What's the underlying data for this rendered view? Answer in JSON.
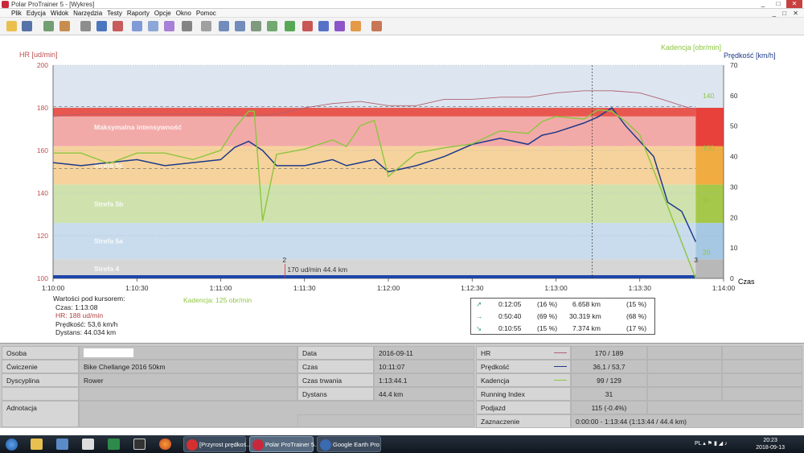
{
  "window": {
    "title": "Polar ProTrainer 5 - [Wykres]",
    "buttons": [
      "_",
      "□",
      "✕"
    ]
  },
  "menu": [
    "Plik",
    "Edycja",
    "Widok",
    "Narzędzia",
    "Testy",
    "Raporty",
    "Opcje",
    "Okno",
    "Pomoc"
  ],
  "toolbar_icons": [
    {
      "name": "open-folder-icon",
      "color": "#e8b530"
    },
    {
      "name": "save-icon",
      "color": "#3a5a99"
    },
    {
      "name": "add-exercise-icon",
      "color": "#5a8f5a"
    },
    {
      "name": "exercise-icon",
      "color": "#c07a30"
    },
    {
      "name": "calendar-icon",
      "color": "#7a7a7a"
    },
    {
      "name": "notebook-icon",
      "color": "#2d5fb5"
    },
    {
      "name": "edit-icon",
      "color": "#c04040"
    },
    {
      "name": "line-chart-icon",
      "color": "#6a8ad0"
    },
    {
      "name": "bar-chart-icon",
      "color": "#7a9ad0"
    },
    {
      "name": "percent-chart-icon",
      "color": "#9a6ad0"
    },
    {
      "name": "table-icon",
      "color": "#707070"
    },
    {
      "name": "zoom-icon",
      "color": "#909090"
    },
    {
      "name": "upload-icon",
      "color": "#5a7ab0"
    },
    {
      "name": "download-icon",
      "color": "#5a7ab0"
    },
    {
      "name": "sync-icon",
      "color": "#6a8a6a"
    },
    {
      "name": "wave-icon",
      "color": "#5a9a5a"
    },
    {
      "name": "report-green-icon",
      "color": "#3a9a3a"
    },
    {
      "name": "report-red-icon",
      "color": "#c03a3a"
    },
    {
      "name": "report-blue-icon",
      "color": "#3a5ac0"
    },
    {
      "name": "report-purple-icon",
      "color": "#7a3ac0"
    },
    {
      "name": "report-orange-icon",
      "color": "#e08a2a"
    },
    {
      "name": "users-icon",
      "color": "#c0603a"
    }
  ],
  "chart_data": {
    "type": "line",
    "left_axis_label": "HR [ud/min]",
    "right_axis_label_cadence": "Kadencja [obr/min]",
    "right_axis_label_speed": "Prędkość [km/h]",
    "x_axis_label": "Czas",
    "x_ticks": [
      "1:10:00",
      "1:10:30",
      "1:11:00",
      "1:11:30",
      "1:12:00",
      "1:12:30",
      "1:13:00",
      "1:13:30",
      "1:14:00"
    ],
    "x_range": [
      0,
      240
    ],
    "hr_ticks": [
      "100",
      "120",
      "140",
      "160",
      "180",
      "200"
    ],
    "hr_range": [
      100,
      200
    ],
    "speed_ticks": [
      "0",
      "10",
      "20",
      "30",
      "40",
      "50",
      "60",
      "70"
    ],
    "speed_range": [
      0,
      70
    ],
    "cadence_ticks": [
      "20",
      "60",
      "100",
      "140"
    ],
    "zones": [
      {
        "label": "Strefa 4",
        "from": 100,
        "to": 109,
        "color": "#d6d6d6",
        "edge_color": "#b8b8b8"
      },
      {
        "label": "Strefa 5a",
        "from": 109,
        "to": 126,
        "color": "#c8dced",
        "edge_color": "#a6c8e2"
      },
      {
        "label": "Strefa 5b",
        "from": 126,
        "to": 144,
        "color": "#cfe2ae",
        "edge_color": "#a6c84a"
      },
      {
        "label": "Strefa 5c",
        "from": 144,
        "to": 162,
        "color": "#f6d39c",
        "edge_color": "#f0ac40"
      },
      {
        "label": "Maksymalna intensywność",
        "from": 162,
        "to": 180,
        "color": "#f2aaa8",
        "edge_color": "#e8403a"
      }
    ],
    "series": [
      {
        "name": "HR",
        "color": "#b06070",
        "x": [
          0,
          10,
          20,
          30,
          40,
          50,
          60,
          70,
          80,
          90,
          100,
          110,
          120,
          130,
          140,
          150,
          160,
          170,
          180,
          190,
          200,
          210,
          218,
          225,
          230
        ],
        "y": [
          176,
          177,
          177,
          177,
          177,
          177,
          177,
          176,
          177,
          180,
          182,
          183,
          181,
          181,
          184,
          184,
          185,
          185,
          187,
          188,
          188,
          187,
          184,
          181,
          179
        ]
      },
      {
        "name": "Prędkość",
        "color": "#1e3a8a",
        "x": [
          0,
          10,
          20,
          30,
          40,
          50,
          60,
          65,
          70,
          75,
          80,
          90,
          100,
          105,
          110,
          115,
          120,
          130,
          140,
          150,
          160,
          170,
          175,
          180,
          190,
          195,
          200,
          205,
          210,
          215,
          220,
          225,
          230
        ],
        "y": [
          38,
          37,
          38,
          39,
          37,
          38,
          39,
          43,
          45,
          42,
          37,
          37,
          39,
          37,
          38,
          39,
          35,
          37,
          40,
          44,
          46,
          44,
          47,
          48,
          51,
          53,
          56,
          50,
          45,
          40,
          25,
          22,
          12
        ]
      },
      {
        "name": "Kadencja",
        "color": "#8cc63f",
        "x": [
          0,
          10,
          20,
          30,
          40,
          50,
          60,
          65,
          70,
          72,
          75,
          80,
          90,
          100,
          105,
          110,
          115,
          120,
          130,
          140,
          150,
          160,
          170,
          175,
          180,
          190,
          195,
          200,
          205,
          210,
          230
        ],
        "y": [
          96,
          96,
          88,
          96,
          96,
          91,
          98,
          115,
          128,
          128,
          44,
          95,
          99,
          106,
          101,
          117,
          121,
          78,
          96,
          100,
          103,
          113,
          111,
          120,
          124,
          122,
          129,
          128,
          120,
          110,
          0
        ]
      }
    ],
    "cursor_x": 193,
    "marker_label": "2",
    "marker_text": "170 ud/min 44.4 km",
    "end_marker_label": "3",
    "grid": true
  },
  "cursor_info": {
    "heading": "Wartości pod kursorem:",
    "czas": "Czas: 1:13:08",
    "hr": "HR: 188 ud/min",
    "predkosc": "Prędkość: 53,6 km/h",
    "dystans": "Dystans: 44.034 km",
    "kadencja": "Kadencja: 125 obr/min"
  },
  "trend": [
    {
      "icon": "↗",
      "time": "0:12:05",
      "pct": "(16 %)",
      "dist": "6.658 km",
      "dpct": "(15 %)"
    },
    {
      "icon": "→",
      "time": "0:50:40",
      "pct": "(69 %)",
      "dist": "30.319 km",
      "dpct": "(68 %)"
    },
    {
      "icon": "↘",
      "time": "0:10:55",
      "pct": "(15 %)",
      "dist": "7.374 km",
      "dpct": "(17 %)"
    }
  ],
  "info": {
    "osoba_label": "Osoba",
    "cwiczenie_label": "Ćwiczenie",
    "cwiczenie_value": "Bike Chellange 2016 50km",
    "dyscyplina_label": "Dyscyplina",
    "dyscyplina_value": "Rower",
    "adnotacja_label": "Adnotacja",
    "data_label": "Data",
    "data_value": "2016-09-11",
    "czas_label": "Czas",
    "czas_value": "10:11:07",
    "czas_trwania_label": "Czas trwania",
    "czas_trwania_value": "1:13:44.1",
    "dystans_label": "Dystans",
    "dystans_value": "44.4 km",
    "hr_label": "HR",
    "hr_value": "170 / 189",
    "predkosc_label": "Prędkość",
    "predkosc_value": "36,1 / 53,7",
    "kadencja_label": "Kadencja",
    "kadencja_value": "99 / 129",
    "running_label": "Running Index",
    "running_value": "31",
    "podjazd_label": "Podjazd",
    "podjazd_value": "115 (-0.4%)",
    "zaznaczenie_label": "Zaznaczenie",
    "zaznaczenie_value": "0:00:00 - 1:13:44 (1:13:44 / 44.4 km)"
  },
  "taskbar": {
    "tasks": [
      {
        "label": "[Przyrost prędkoś...",
        "icon_color": "#d43030"
      },
      {
        "label": "Polar ProTrainer 5...",
        "icon_color": "#c8283c"
      },
      {
        "label": "Google Earth Pro",
        "icon_color": "#3a6ab0"
      }
    ],
    "tray": "PL",
    "time": "20:23",
    "date": "2018-09-13"
  }
}
